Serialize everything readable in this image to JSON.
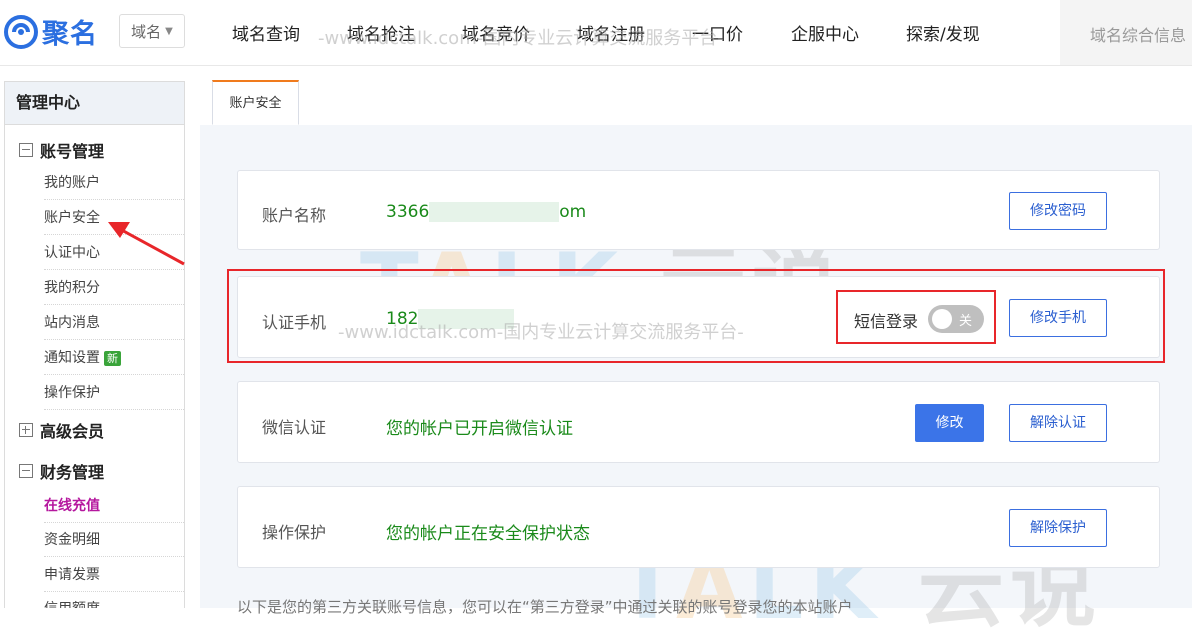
{
  "header": {
    "logo_text": "聚名",
    "domain_select": "域名",
    "nav": [
      "域名查询",
      "域名抢注",
      "域名竞价",
      "域名注册",
      "一口价",
      "企服中心",
      "探索/发现"
    ],
    "search_placeholder": "域名综合信息"
  },
  "sidebar": {
    "title": "管理中心",
    "groups": {
      "account": "账号管理",
      "vip": "高级会员",
      "finance": "财务管理"
    },
    "account_items": [
      "我的账户",
      "账户安全",
      "认证中心",
      "我的积分",
      "站内消息",
      "通知设置",
      "操作保护"
    ],
    "new_badge": "新",
    "finance_items": [
      "在线充值",
      "资金明细",
      "申请发票",
      "信用额度"
    ]
  },
  "tab": {
    "label": "账户安全"
  },
  "cards": {
    "account": {
      "label": "账户名称",
      "value_prefix": "3366",
      "value_suffix": "om",
      "button": "修改密码"
    },
    "phone": {
      "label": "认证手机",
      "value_prefix": "182",
      "sms_label": "短信登录",
      "toggle_text": "关",
      "button": "修改手机"
    },
    "wechat": {
      "label": "微信认证",
      "value": "您的帐户已开启微信认证",
      "button_primary": "修改",
      "button_secondary": "解除认证"
    },
    "protect": {
      "label": "操作保护",
      "value": "您的帐户正在安全保护状态",
      "button": "解除保护"
    }
  },
  "note": "以下是您的第三方关联账号信息，您可以在“第三方登录”中通过关联的账号登录您的本站账户",
  "watermark": {
    "line": "-www.idctalk.com-国内专业云计算交流服务平台-",
    "brand": "TALK",
    "brand_cn": "云说"
  },
  "colors": {
    "brand_blue": "#2b6fe0",
    "value_green": "#1a8a1a",
    "highlight_red": "#e8262a",
    "tab_orange": "#f07b1d",
    "active_purple": "#b5179e"
  }
}
